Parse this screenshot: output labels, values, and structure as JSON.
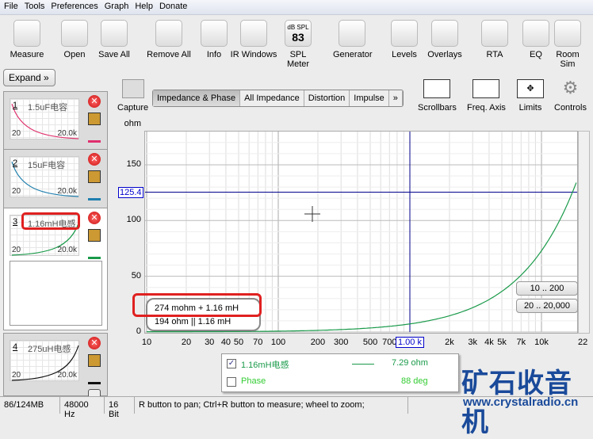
{
  "menu": [
    "File",
    "Tools",
    "Preferences",
    "Graph",
    "Help",
    "Donate"
  ],
  "toolbar": [
    {
      "label": "Measure",
      "icon": "measure-icon"
    },
    {
      "label": "Open",
      "icon": "folder-icon"
    },
    {
      "label": "Save All",
      "icon": "save-icon"
    },
    {
      "label": "Remove All",
      "icon": "remove-icon"
    },
    {
      "label": "Info",
      "icon": "info-icon"
    },
    {
      "label": "IR Windows",
      "icon": "ir-windows-icon"
    },
    {
      "label": "SPL Meter",
      "icon": "spl-meter-icon",
      "badge": "dB SPL",
      "value": "83"
    },
    {
      "label": "Generator",
      "icon": "sine-icon"
    },
    {
      "label": "Levels",
      "icon": "levels-icon"
    },
    {
      "label": "Overlays",
      "icon": "overlays-icon"
    },
    {
      "label": "RTA",
      "icon": "rta-icon"
    },
    {
      "label": "EQ",
      "icon": "eq-icon"
    },
    {
      "label": "Room Sim",
      "icon": "room-sim-icon"
    }
  ],
  "sidebar": {
    "expand": "Expand",
    "measurements": [
      {
        "num": "1",
        "name": "1.5uF电容",
        "from": "20",
        "to": "20.0k",
        "color": "#e0306e"
      },
      {
        "num": "2",
        "name": "15uF电容",
        "from": "20",
        "to": "20.0k",
        "color": "#1f7fae"
      },
      {
        "num": "3",
        "name": "1.16mH电感",
        "from": "20",
        "to": "20.0k",
        "color": "#1a9a4a"
      },
      {
        "num": "4",
        "name": "275uH电感",
        "from": "20",
        "to": "20.0k",
        "color": "#111111"
      }
    ]
  },
  "graph": {
    "capture": "Capture",
    "tabs": [
      "Impedance & Phase",
      "All Impedance",
      "Distortion",
      "Impulse",
      "»"
    ],
    "active_tab": 0,
    "right_tools": [
      "Scrollbars",
      "Freq. Axis",
      "Limits",
      "Controls"
    ],
    "y_unit": "ohm",
    "y_ticks": [
      "0",
      "50",
      "100",
      "150"
    ],
    "x_ticks": [
      "10",
      "20",
      "30",
      "40",
      "50",
      "70",
      "100",
      "200",
      "300",
      "500",
      "700",
      "2k",
      "3k",
      "4k",
      "5k",
      "7k",
      "10k",
      "22"
    ],
    "cursor_y": "125.4",
    "cursor_x": "1.00 k",
    "model_series": "274 mohm + 1.16 mH",
    "model_parallel": "194 ohm || 1.16 mH",
    "range_y": "10 .. 200",
    "range_x": "20 .. 20,000",
    "series_color": "#1a9a4a"
  },
  "chart_data": {
    "type": "line",
    "xscale": "log",
    "xlim": [
      10,
      22000
    ],
    "ylim": [
      0,
      165
    ],
    "ylabel": "ohm",
    "series": [
      {
        "name": "1.16mH电感",
        "model": {
          "R_ohm": 0.274,
          "L_mH": 1.16
        }
      }
    ]
  },
  "legend": [
    {
      "label": "1.16mH电感",
      "value": "7.29 ohm",
      "checked": true
    },
    {
      "label": "Phase",
      "value": "88 deg",
      "checked": false
    }
  ],
  "status": [
    "86/124MB",
    "48000 Hz",
    "16 Bit",
    "R button to pan; Ctrl+R button to measure; wheel to zoom;"
  ],
  "watermark": {
    "cn": "矿石收音机",
    "url": "www.crystalradio.cn"
  }
}
